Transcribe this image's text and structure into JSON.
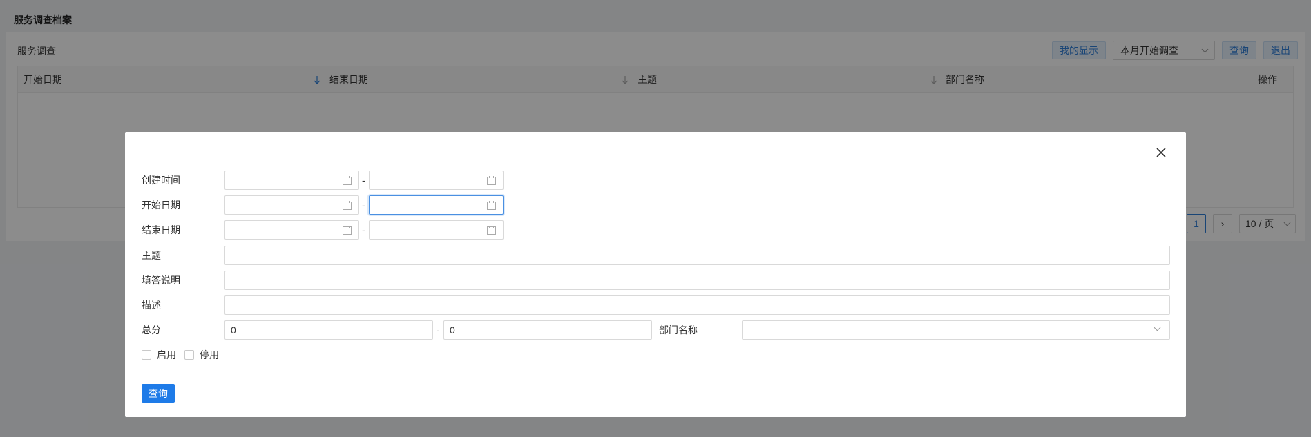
{
  "page": {
    "title": "服务调查档案"
  },
  "panel": {
    "title": "服务调查",
    "toolbar": {
      "my_display": "我的显示",
      "filter_select": "本月开始调查",
      "query": "查询",
      "exit": "退出"
    },
    "table": {
      "columns": [
        "开始日期",
        "结束日期",
        "主题",
        "部门名称",
        "操作"
      ]
    },
    "pagination": {
      "current_page": "1",
      "next": "›",
      "page_size": "10 / 页"
    }
  },
  "modal": {
    "fields": {
      "created_time": "创建时间",
      "start_date": "开始日期",
      "end_date": "结束日期",
      "subject": "主题",
      "fill_instructions": "填答说明",
      "description": "描述",
      "total_score": "总分",
      "department": "部门名称"
    },
    "range_separator": "-",
    "total_score_min": "0",
    "total_score_max": "0",
    "checkboxes": {
      "enabled": "启用",
      "disabled": "停用"
    },
    "query_button": "查询"
  },
  "colors": {
    "primary": "#1e7be8",
    "mask": "rgba(0,0,0,0.45)"
  }
}
